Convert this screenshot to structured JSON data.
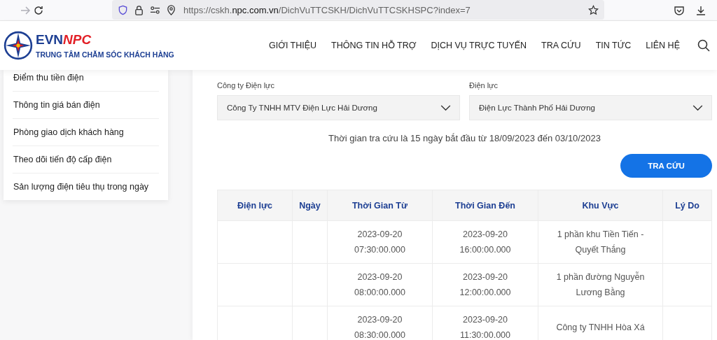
{
  "browser": {
    "url_prefix": "https://cskh.",
    "url_domain": "npc.com.vn",
    "url_path": "/DichVuTTCSKH/DichVuTTCSKHSPC?index=7"
  },
  "header": {
    "logo_part1": "EVN",
    "logo_part2": "NPC",
    "tagline": "TRUNG TÂM CHĂM SÓC KHÁCH HÀNG",
    "nav": [
      "GIỚI THIỆU",
      "THÔNG TIN HỖ TRỢ",
      "DỊCH VỤ TRỰC TUYẾN",
      "TRA CỨU",
      "TIN TỨC",
      "LIÊN HỆ"
    ]
  },
  "sidebar": {
    "items": [
      "Điểm thu tiền điện",
      "Thông tin giá bán điện",
      "Phòng giao dịch khách hàng",
      "Theo dõi tiến độ cấp điện",
      "Sản lượng điện tiêu thụ trong ngày"
    ]
  },
  "form": {
    "fields": [
      {
        "label": "Công ty Điện lực",
        "value": "Công Ty TNHH MTV Điện Lực Hải Dương"
      },
      {
        "label": "Điện lực",
        "value": "Điện Lực Thành Phố Hải Dương"
      }
    ],
    "note": "Thời gian tra cứu là 15 ngày bắt đầu từ 18/09/2023 đến 03/10/2023",
    "button": "TRA CỨU"
  },
  "table": {
    "columns": [
      "Điện lực",
      "Ngày",
      "Thời Gian Từ",
      "Thời Gian Đến",
      "Khu Vực",
      "Lý Do"
    ],
    "rows": [
      [
        "",
        "",
        "2023-09-20 07:30:00.000",
        "2023-09-20 16:00:00.000",
        "1 phần khu Tiền Tiến - Quyết Thắng",
        ""
      ],
      [
        "",
        "",
        "2023-09-20 08:00:00.000",
        "2023-09-20 12:00:00.000",
        "1 phần đường Nguyễn Lương Bằng",
        ""
      ],
      [
        "",
        "",
        "2023-09-20 08:30:00.000",
        "2023-09-20 11:30:00.000",
        "Công ty TNHH Hòa Xá",
        ""
      ]
    ]
  }
}
